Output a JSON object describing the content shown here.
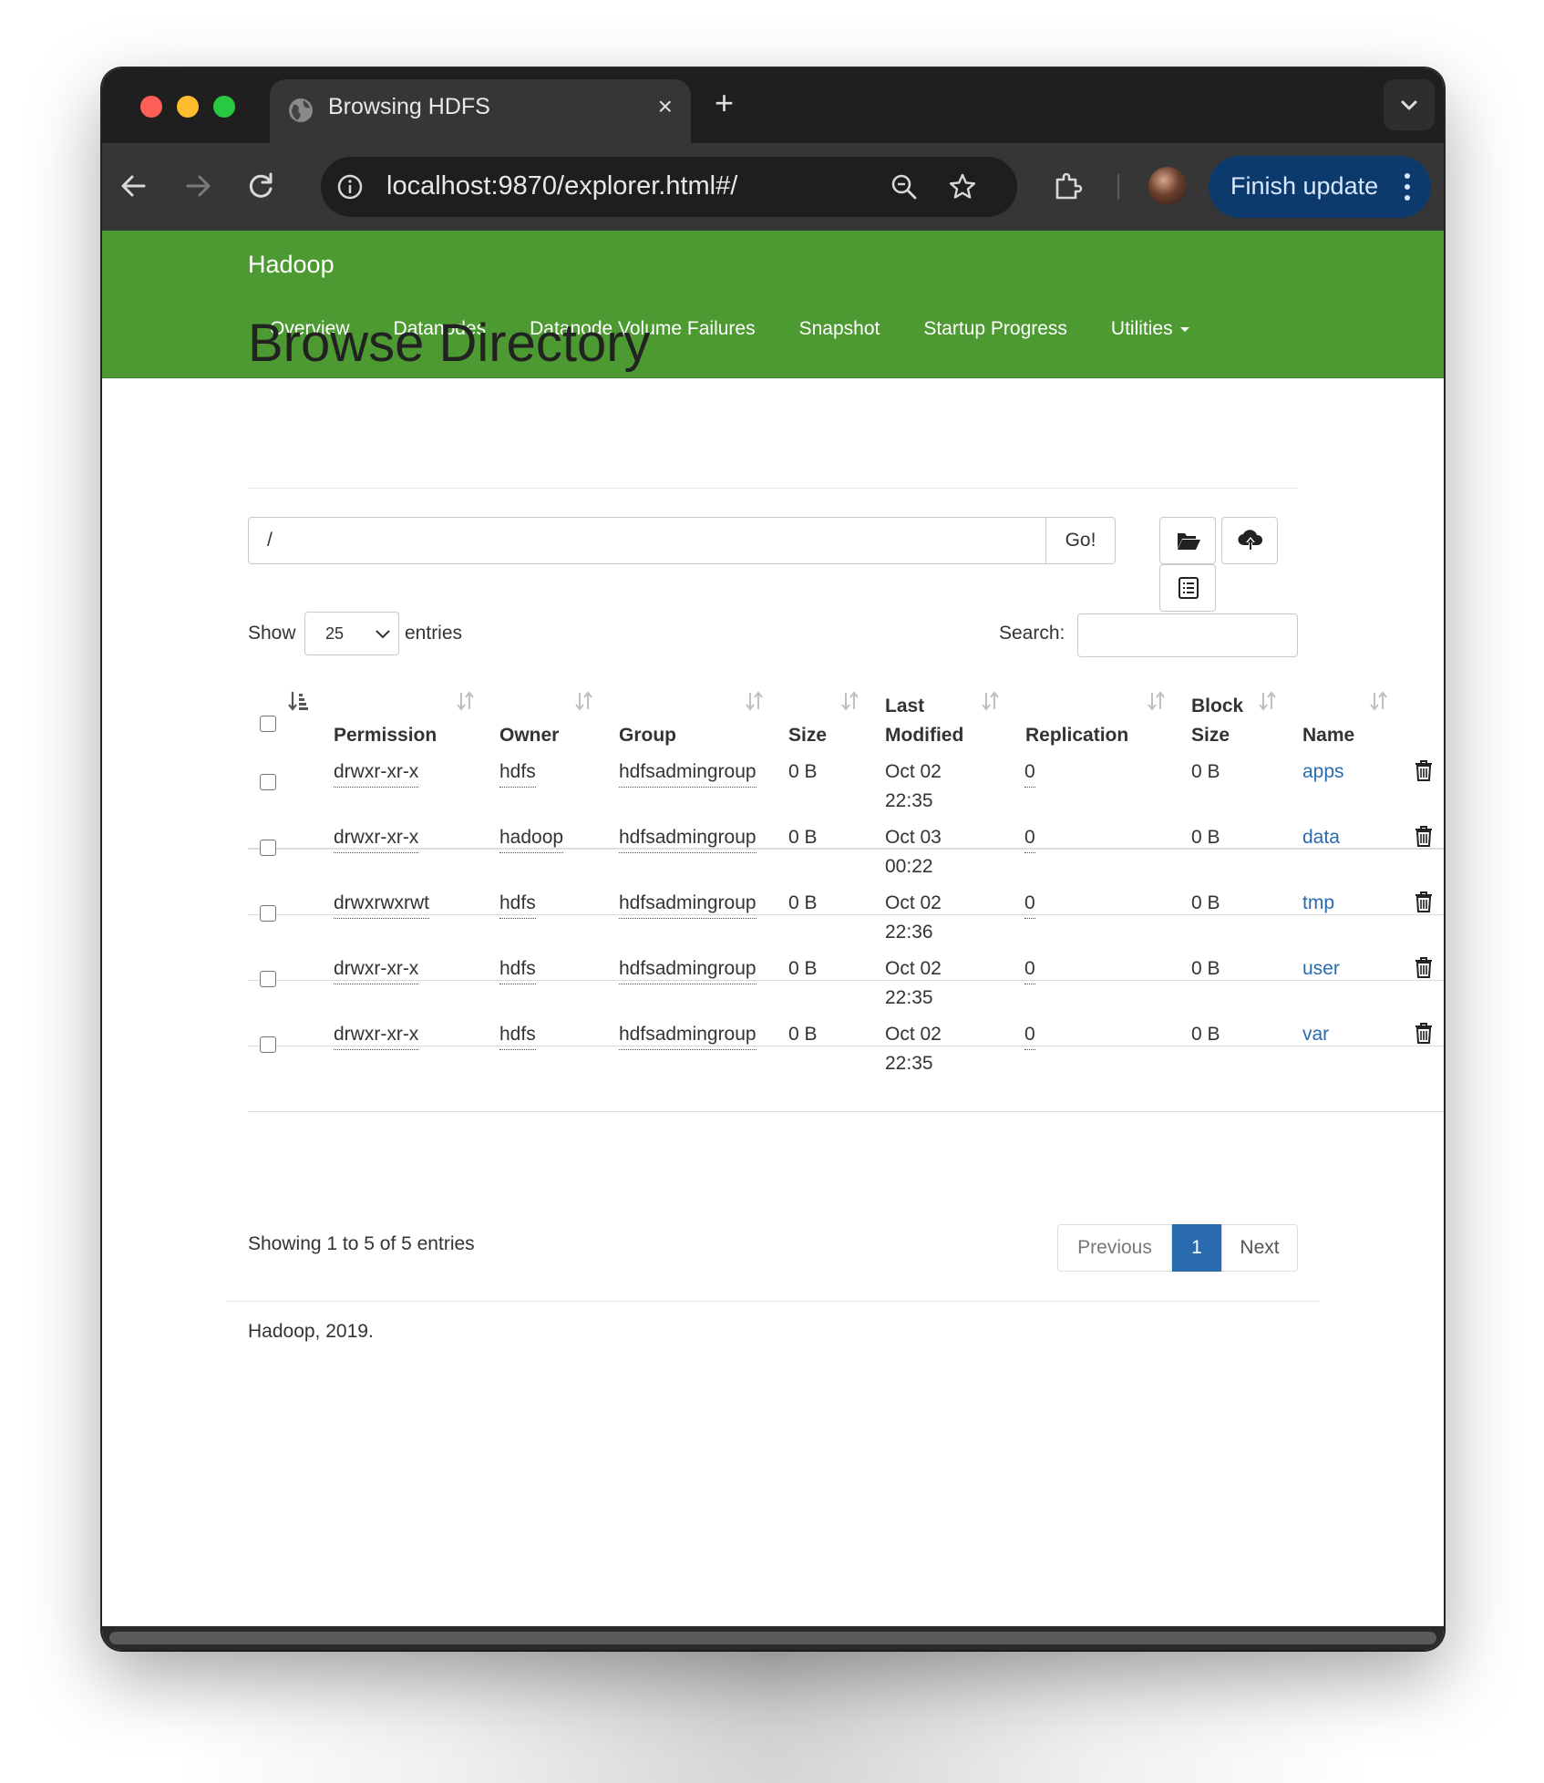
{
  "browser": {
    "tab_title": "Browsing HDFS",
    "tab_close_glyph": "×",
    "new_tab_glyph": "+",
    "url": "localhost:9870/explorer.html#/",
    "finish_update_label": "Finish update"
  },
  "navbar": {
    "brand": "Hadoop",
    "links": [
      "Overview",
      "Datanodes",
      "Datanode Volume Failures",
      "Snapshot",
      "Startup Progress",
      "Utilities"
    ]
  },
  "main": {
    "title": "Browse Directory",
    "path_value": "/",
    "go_label": "Go!",
    "show_label": "Show",
    "entries_value": "25",
    "entries_label": "entries",
    "search_label": "Search:",
    "columns": [
      "Permission",
      "Owner",
      "Group",
      "Size",
      "Last",
      "Modified",
      "Replication",
      "Block",
      "Size",
      "Name"
    ],
    "rows": [
      {
        "permission": "drwxr-xr-x",
        "owner": "hdfs",
        "group": "hdfsadmingroup",
        "size": "0 B",
        "date": "Oct 02",
        "time": "22:35",
        "replication": "0",
        "block_size": "0 B",
        "name": "apps"
      },
      {
        "permission": "drwxr-xr-x",
        "owner": "hadoop",
        "group": "hdfsadmingroup",
        "size": "0 B",
        "date": "Oct 03",
        "time": "00:22",
        "replication": "0",
        "block_size": "0 B",
        "name": "data"
      },
      {
        "permission": "drwxrwxrwt",
        "owner": "hdfs",
        "group": "hdfsadmingroup",
        "size": "0 B",
        "date": "Oct 02",
        "time": "22:36",
        "replication": "0",
        "block_size": "0 B",
        "name": "tmp"
      },
      {
        "permission": "drwxr-xr-x",
        "owner": "hdfs",
        "group": "hdfsadmingroup",
        "size": "0 B",
        "date": "Oct 02",
        "time": "22:35",
        "replication": "0",
        "block_size": "0 B",
        "name": "user"
      },
      {
        "permission": "drwxr-xr-x",
        "owner": "hdfs",
        "group": "hdfsadmingroup",
        "size": "0 B",
        "date": "Oct 02",
        "time": "22:35",
        "replication": "0",
        "block_size": "0 B",
        "name": "var"
      }
    ],
    "showing_text": "Showing 1 to 5 of 5 entries",
    "pagination": {
      "previous": "Previous",
      "current": "1",
      "next": "Next"
    },
    "footer": "Hadoop, 2019."
  },
  "colors": {
    "navbar_green": "#4e9a32",
    "link_blue": "#2a6bb0",
    "finish_update_bg": "#0c3a6c"
  }
}
